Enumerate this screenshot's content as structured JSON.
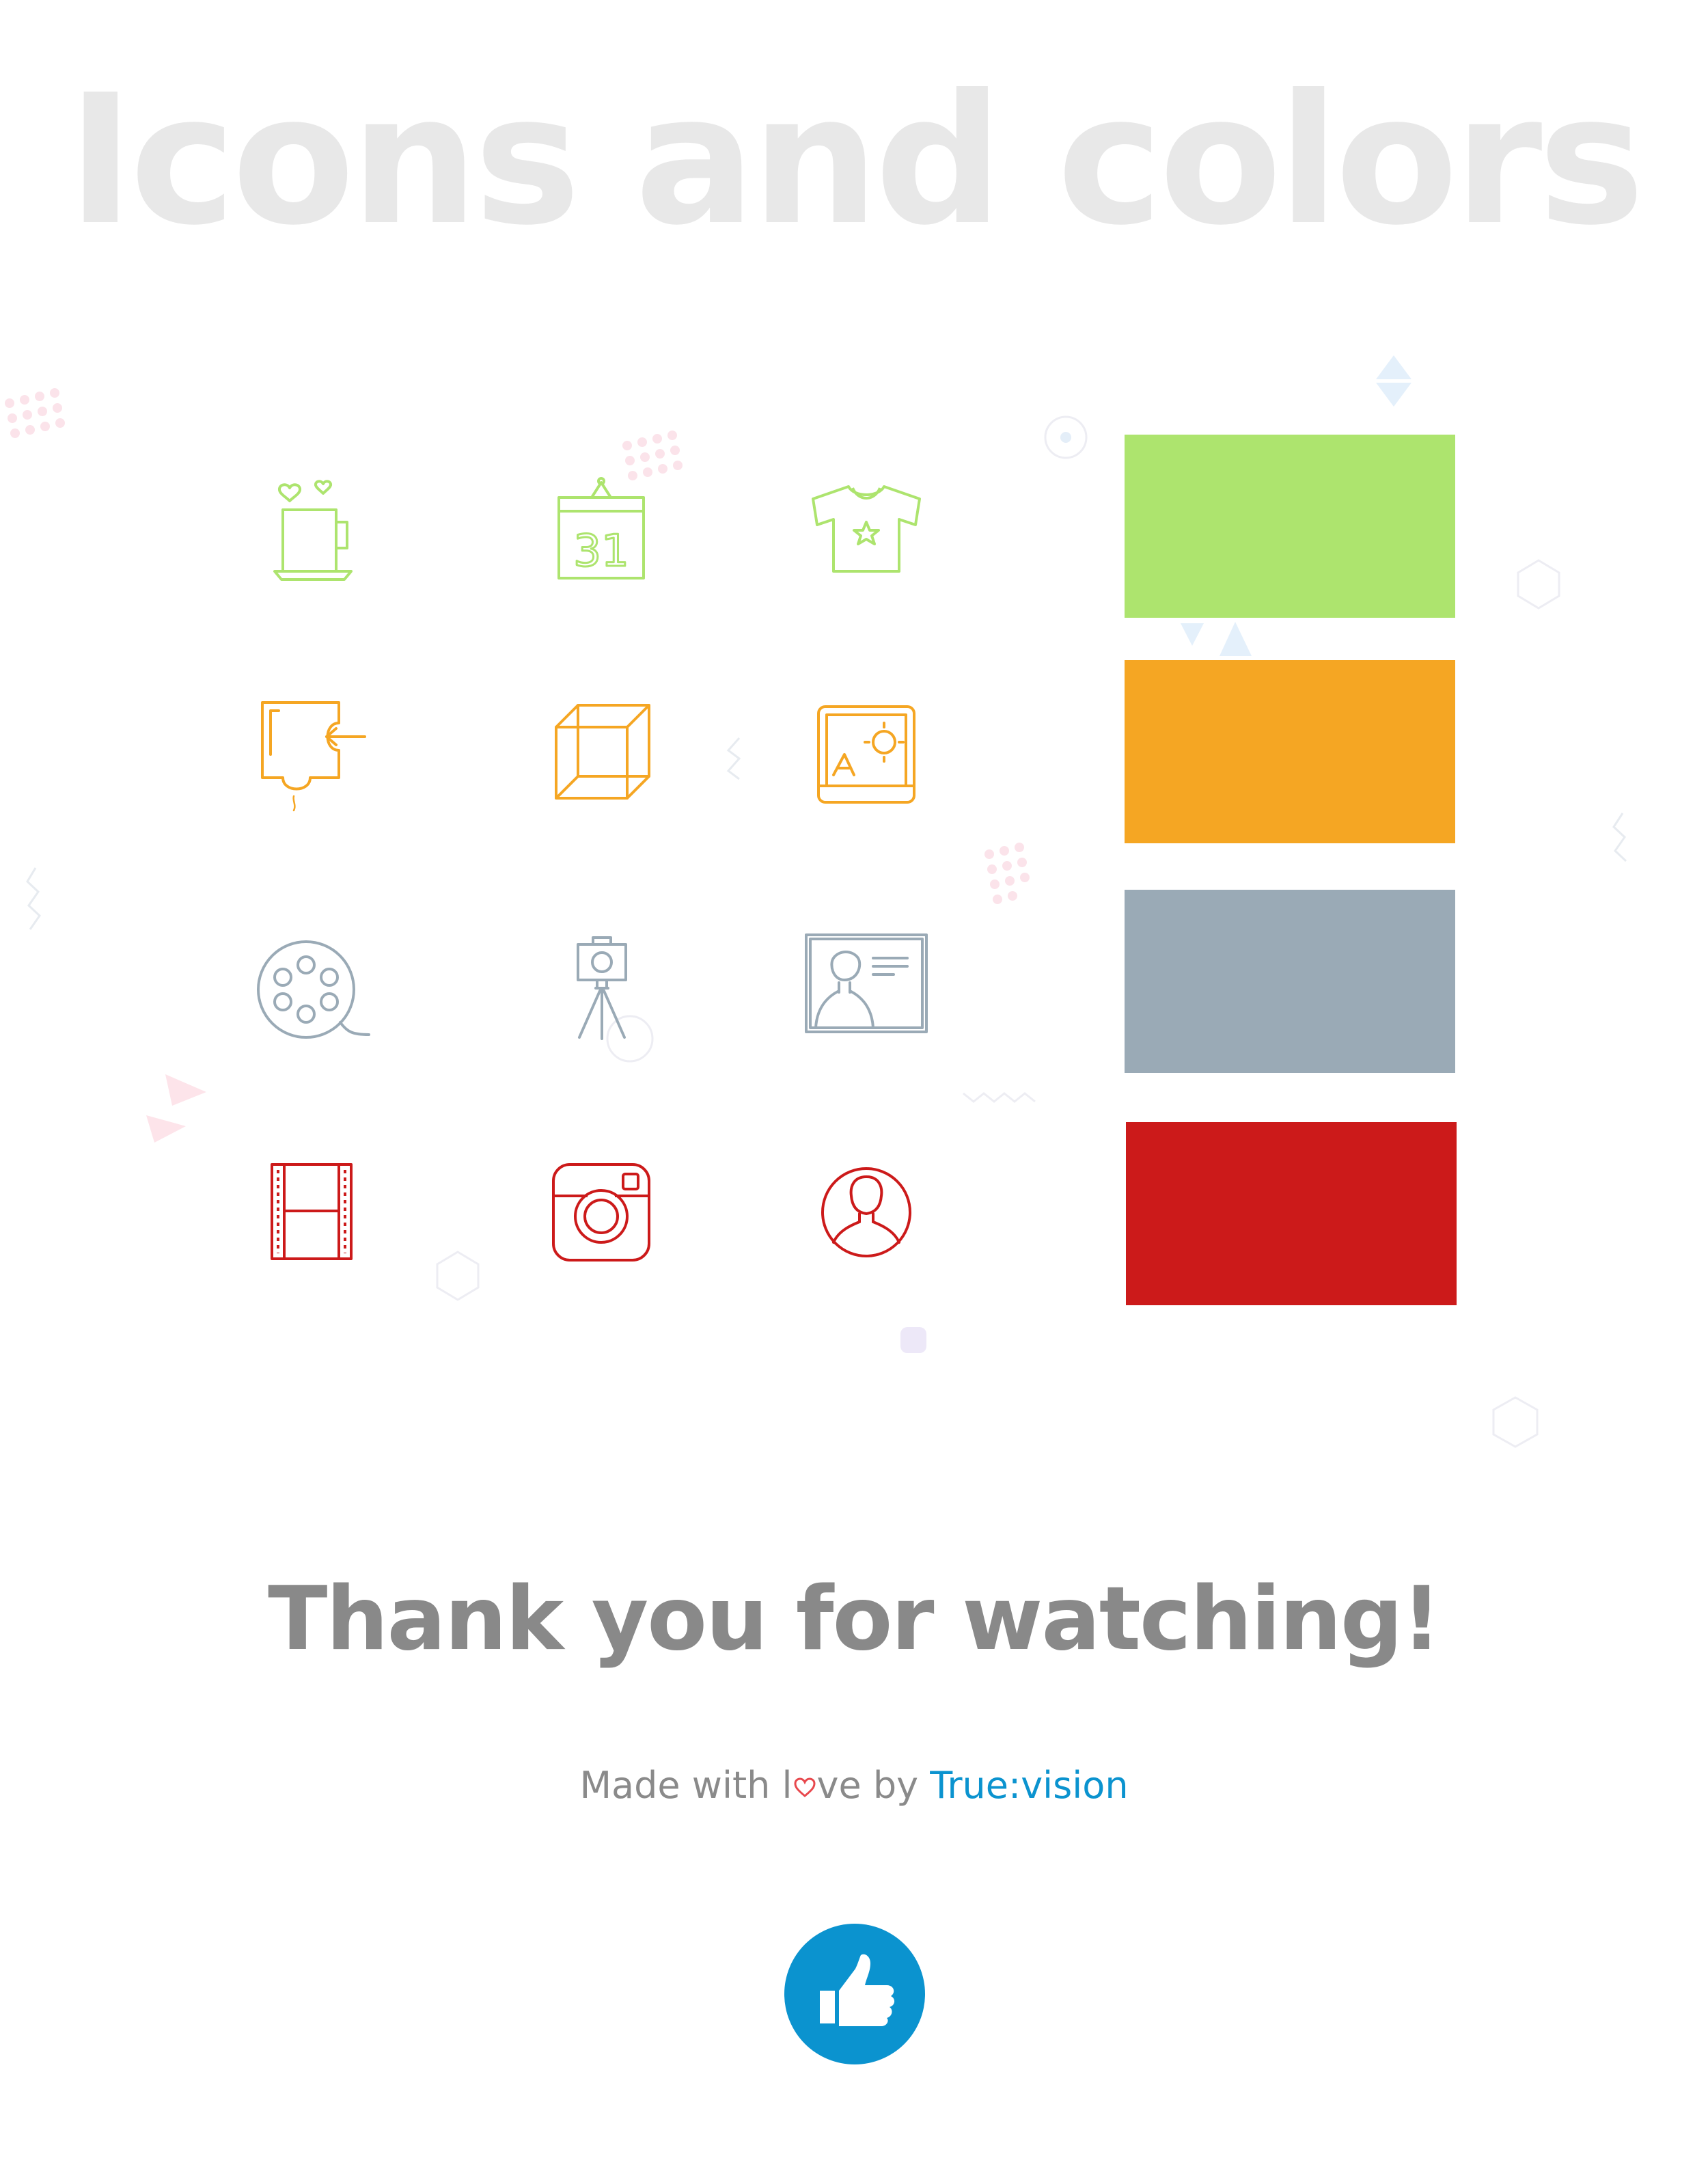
{
  "header": {
    "title": "Icons and colors"
  },
  "palette": {
    "green": "#ade46e",
    "orange": "#f5a623",
    "gray": "#9aaab6",
    "red": "#cc1a1a",
    "brand_blue": "#0b93cf",
    "title_gray": "#e8e8e8"
  },
  "icon_grid": [
    {
      "color": "green",
      "icons": [
        "coffee-cup-icon",
        "wall-calendar-icon",
        "t-shirt-icon"
      ]
    },
    {
      "color": "orange",
      "icons": [
        "puzzle-piece-icon",
        "cube-icon",
        "landscape-picture-icon"
      ]
    },
    {
      "color": "gray",
      "icons": [
        "film-reel-icon",
        "camera-tripod-icon",
        "id-card-icon"
      ]
    },
    {
      "color": "red",
      "icons": [
        "film-strip-icon",
        "instagram-camera-icon",
        "user-portrait-icon"
      ]
    }
  ],
  "calendar_day": "31",
  "footer": {
    "thanks": "Thank you for watching!",
    "made_with_before": "Made with l",
    "made_with_after": "ve by ",
    "brand": "True:vision"
  },
  "like_button": {
    "icon": "thumbs-up-icon"
  }
}
